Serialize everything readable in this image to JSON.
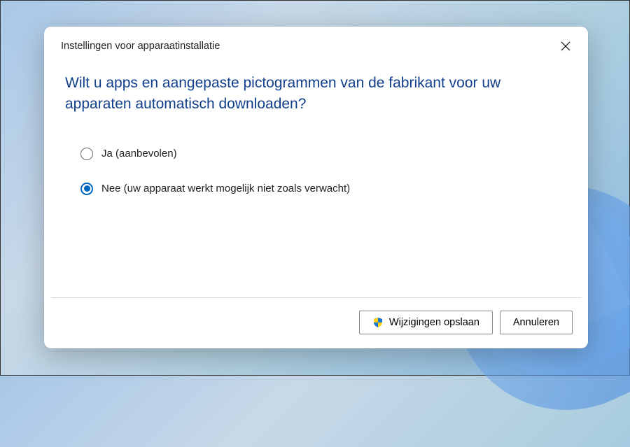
{
  "dialog": {
    "title": "Instellingen voor apparaatinstallatie",
    "heading": "Wilt u apps en aangepaste pictogrammen van de fabrikant voor uw apparaten automatisch downloaden?",
    "options": [
      {
        "label": "Ja (aanbevolen)",
        "selected": false
      },
      {
        "label": "Nee (uw apparaat werkt mogelijk niet zoals verwacht)",
        "selected": true
      }
    ],
    "buttons": {
      "save": "Wijzigingen opslaan",
      "cancel": "Annuleren"
    }
  }
}
